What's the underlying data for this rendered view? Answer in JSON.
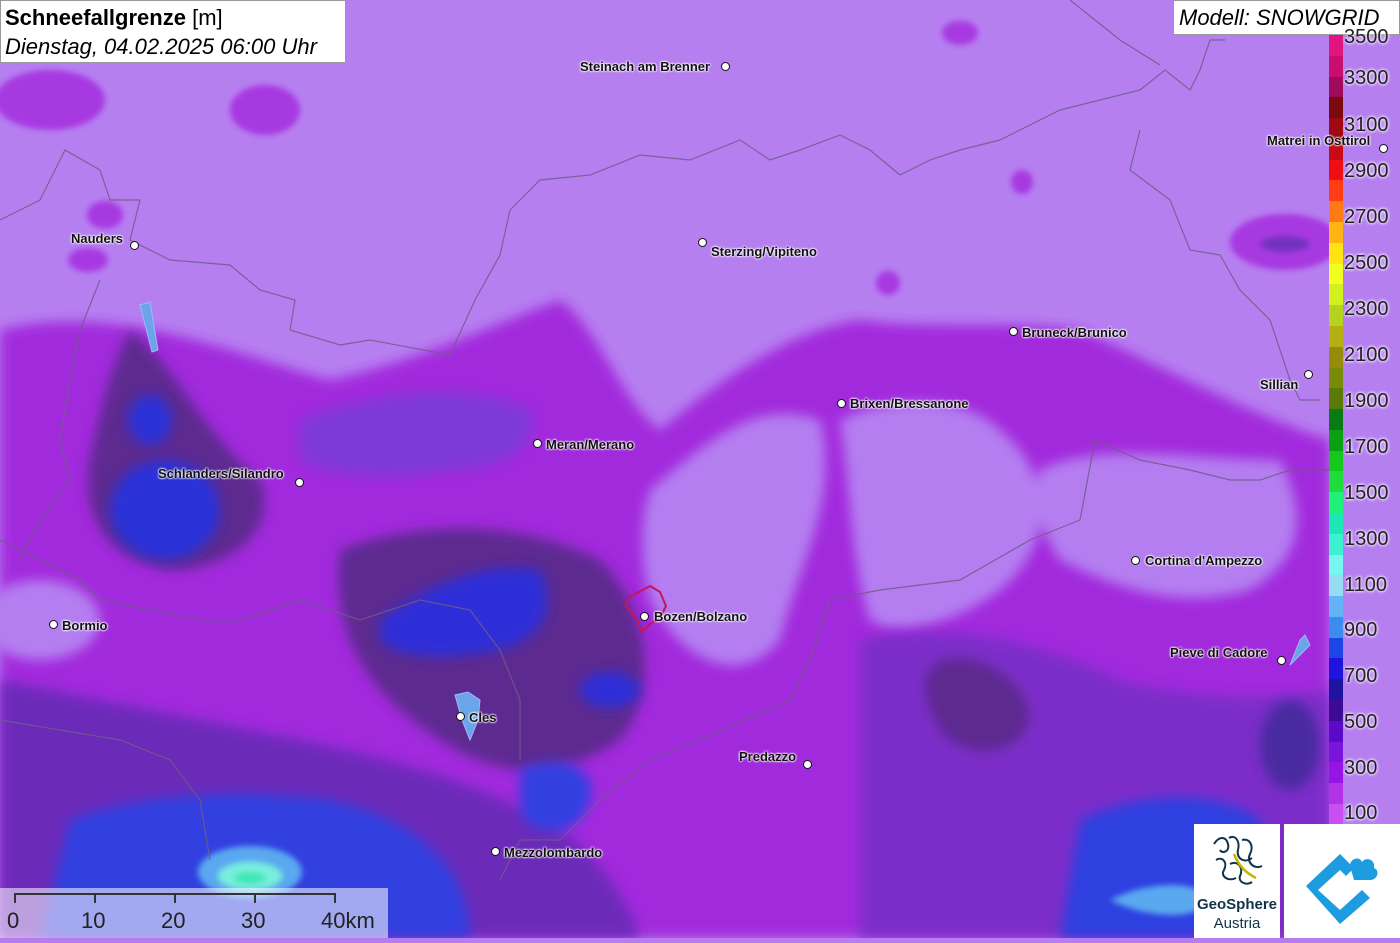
{
  "title": {
    "variable": "Schneefallgrenze",
    "unit": "[m]",
    "datetime": "Dienstag, 04.02.2025 06:00 Uhr"
  },
  "model_label": "Modell: SNOWGRID",
  "legend": {
    "labels": [
      "3500",
      "3300",
      "3100",
      "2900",
      "2700",
      "2500",
      "2300",
      "2100",
      "1900",
      "1700",
      "1500",
      "1300",
      "1100",
      "900",
      "700",
      "500",
      "300",
      "100"
    ],
    "colors": [
      "#e0157f",
      "#c80e6e",
      "#a00a5a",
      "#7a0a10",
      "#a00812",
      "#c80a14",
      "#ee0e14",
      "#ff3c14",
      "#ff7a14",
      "#ffb414",
      "#ffe414",
      "#f0ff1e",
      "#d2f01e",
      "#b4d21e",
      "#b4b014",
      "#968c0a",
      "#788c0a",
      "#5a7a0a",
      "#0a7a14",
      "#0aa014",
      "#14c81e",
      "#1edc3c",
      "#1ef07a",
      "#1ee6b4",
      "#3cf0d2",
      "#78f5f0",
      "#96dcf5",
      "#64b4f5",
      "#3c8cf0",
      "#1e46e6",
      "#1e14dc",
      "#1e14a0",
      "#3c0a96",
      "#5a0ac8",
      "#7814dc",
      "#9614e6",
      "#b432e6",
      "#c850f0"
    ]
  },
  "cities": [
    {
      "name": "Steinach am Brenner"
    },
    {
      "name": "Nauders"
    },
    {
      "name": "Sterzing/Vipiteno"
    },
    {
      "name": "Matrei in Osttirol"
    },
    {
      "name": "Bruneck/Brunico"
    },
    {
      "name": "Sillian"
    },
    {
      "name": "Brixen/Bressanone"
    },
    {
      "name": "Meran/Merano"
    },
    {
      "name": "Schlanders/Silandro"
    },
    {
      "name": "Cortina d'Ampezzo"
    },
    {
      "name": "Bozen/Bolzano"
    },
    {
      "name": "Bormio"
    },
    {
      "name": "Pieve di Cadore"
    },
    {
      "name": "Cles"
    },
    {
      "name": "Predazzo"
    },
    {
      "name": "Mezzolombardo"
    }
  ],
  "scale": {
    "labels": [
      "0",
      "10",
      "20",
      "30",
      "40km"
    ]
  },
  "logos": {
    "geosphere_line1": "GeoSphere",
    "geosphere_line2": "Austria"
  },
  "colors": {
    "light": "#b47ef0",
    "mid": "#9b3fe0",
    "magenta": "#a020d8",
    "dark": "#5a2a8c",
    "blue": "#3c2ad8",
    "deepblue": "#2a36e0",
    "cyan": "#46e6c8"
  }
}
